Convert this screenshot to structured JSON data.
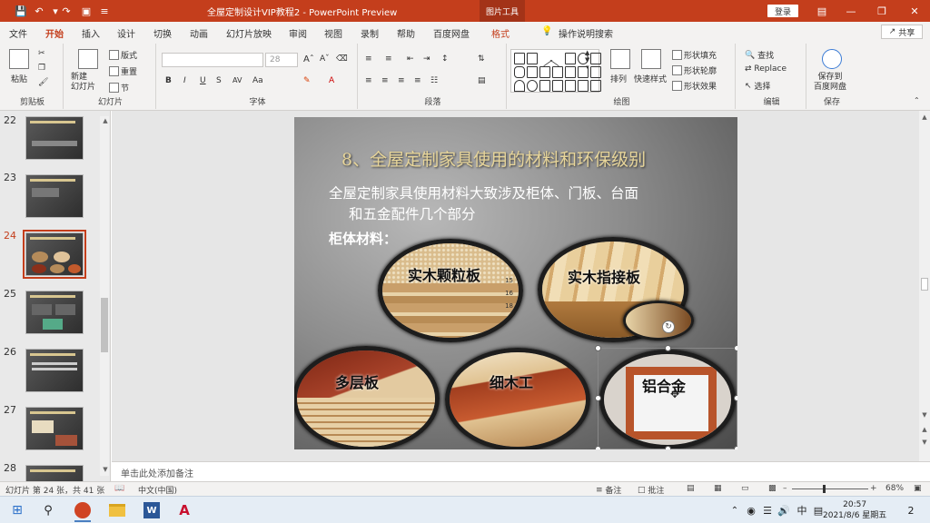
{
  "titlebar": {
    "title": "全屋定制设计VIP教程2 - PowerPoint Preview",
    "context_tool": "图片工具",
    "login": "登录",
    "quick_access": [
      "save-icon",
      "undo-icon",
      "redo-icon",
      "present-icon",
      "customize-icon"
    ]
  },
  "tabs": [
    {
      "label": "文件"
    },
    {
      "label": "开始"
    },
    {
      "label": "插入"
    },
    {
      "label": "设计"
    },
    {
      "label": "切换"
    },
    {
      "label": "动画"
    },
    {
      "label": "幻灯片放映"
    },
    {
      "label": "审阅"
    },
    {
      "label": "视图"
    },
    {
      "label": "录制"
    },
    {
      "label": "帮助"
    },
    {
      "label": "百度网盘"
    },
    {
      "label": "格式"
    }
  ],
  "tell_me": "操作说明搜索",
  "share": "共享",
  "ribbon": {
    "clipboard": {
      "label": "剪贴板",
      "paste": "粘贴"
    },
    "slides": {
      "label": "幻灯片",
      "new_slide": "新建\n幻灯片",
      "layout": "版式",
      "reset": "重置",
      "section": "节"
    },
    "font": {
      "label": "字体",
      "font_size": "28",
      "buttons": [
        "B",
        "I",
        "U",
        "S",
        "AV",
        "Aa"
      ]
    },
    "paragraph": {
      "label": "段落"
    },
    "drawing": {
      "label": "绘图",
      "arrange": "排列",
      "quick_styles": "快速样式",
      "shape_fill": "形状填充",
      "shape_outline": "形状轮廓",
      "shape_effects": "形状效果"
    },
    "editing": {
      "label": "编辑",
      "find": "查找",
      "replace": "Replace",
      "select": "选择"
    },
    "save": {
      "label": "保存",
      "save_to_cloud": "保存到\n百度网盘"
    }
  },
  "thumbnails": [
    {
      "num": "22"
    },
    {
      "num": "23"
    },
    {
      "num": "24",
      "selected": true
    },
    {
      "num": "25"
    },
    {
      "num": "26"
    },
    {
      "num": "27"
    },
    {
      "num": "28"
    }
  ],
  "slide": {
    "heading": "8、全屋定制家具使用的材料和环保级别",
    "line1": "全屋定制家具使用材料大致涉及柜体、门板、台面",
    "line2": "和五金配件几个部分",
    "line3": "柜体材料：",
    "materials": [
      {
        "label": "实木颗粒板",
        "color_a": "#cfae7d",
        "color_b": "#e3cfa6"
      },
      {
        "label": "实木指接板",
        "color_a": "#d9b882",
        "color_b": "#f0dcb4"
      },
      {
        "label": "多层板",
        "color_a": "#8b2f1a",
        "color_b": "#d5b88c"
      },
      {
        "label": "细木工",
        "color_a": "#9a3b1c",
        "color_b": "#e2c598"
      },
      {
        "label": "铝合金",
        "color_a": "#b8542a",
        "color_b": "#f2f2f2"
      }
    ],
    "ruler_marks": [
      "15",
      "16",
      "18"
    ]
  },
  "notes_placeholder": "单击此处添加备注",
  "statusbar": {
    "slide_info": "幻灯片 第 24 张，共 41 张",
    "language": "中文(中国)",
    "notes": "备注",
    "comments": "批注",
    "zoom": "68%"
  },
  "taskbar": {
    "time": "20:57",
    "date": "2021/8/6 星期五",
    "ime": "中",
    "notification_count": "2"
  }
}
